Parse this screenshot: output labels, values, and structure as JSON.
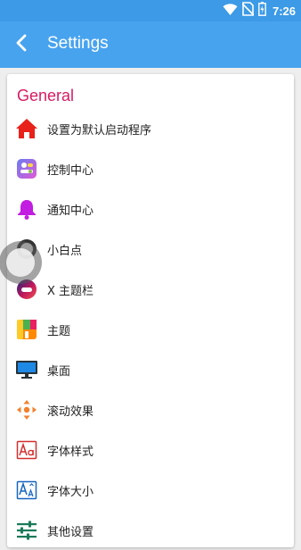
{
  "status_bar": {
    "time": "7:26",
    "icons": [
      "wifi-icon",
      "no-sim-icon",
      "battery-charging-icon"
    ]
  },
  "app_bar": {
    "title": "Settings",
    "back_icon": "arrow-back-icon"
  },
  "colors": {
    "app_bar": "#48a3ef",
    "status_bar": "#3c9ae6",
    "section_title": "#d81b60"
  },
  "section": {
    "title": "General",
    "items": [
      {
        "label": "设置为默认启动程序",
        "icon": "home-icon"
      },
      {
        "label": "控制中心",
        "icon": "control-center-icon"
      },
      {
        "label": "通知中心",
        "icon": "bell-icon"
      },
      {
        "label": "小白点",
        "icon": "assistive-dot-icon"
      },
      {
        "label": "X 主题栏",
        "icon": "x-theme-bar-icon"
      },
      {
        "label": "主题",
        "icon": "theme-icon"
      },
      {
        "label": "桌面",
        "icon": "desktop-monitor-icon"
      },
      {
        "label": "滚动效果",
        "icon": "scroll-effect-icon"
      },
      {
        "label": "字体样式",
        "icon": "font-style-icon"
      },
      {
        "label": "字体大小",
        "icon": "font-size-icon"
      },
      {
        "label": "其他设置",
        "icon": "sliders-icon"
      }
    ]
  },
  "floating_button": {
    "icon": "assistive-touch-icon"
  }
}
